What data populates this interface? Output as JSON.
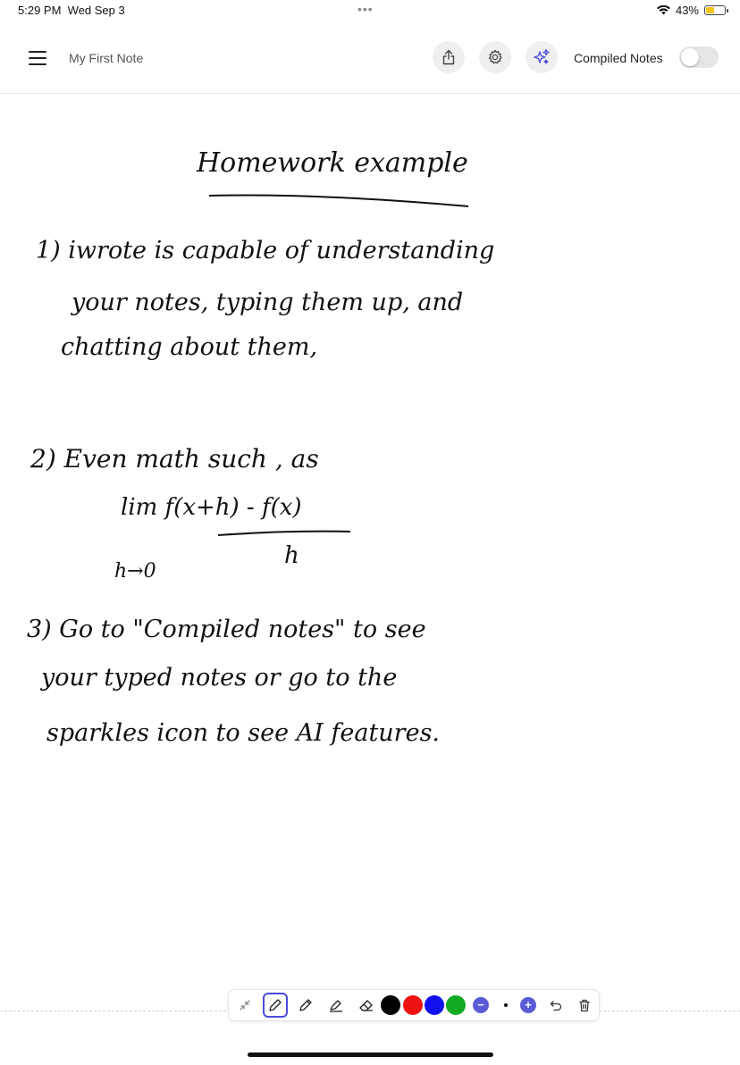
{
  "status_bar": {
    "time": "5:29 PM",
    "date": "Wed Sep 3",
    "battery": "43%",
    "battery_level": 0.43
  },
  "header": {
    "title": "My First Note",
    "compiled_label": "Compiled Notes",
    "compiled_enabled": false,
    "icons": [
      "menu-icon",
      "share-icon",
      "settings-icon",
      "sparkles-icon"
    ]
  },
  "note": {
    "heading": "Homework example",
    "lines": [
      "1) iwrote is capable of understanding",
      "your notes, typing them up, and",
      "chatting about them,",
      "2) Even math such , as",
      "lim f(x+h) - f(x)",
      "h",
      "h→0",
      "3) Go to \"Compiled notes\" to see",
      "your typed notes or go to the",
      "sparkles icon to see AI features."
    ]
  },
  "toolbar": {
    "tools": [
      "collapse-icon",
      "pen-icon",
      "pencil-icon",
      "highlighter-icon",
      "eraser-icon"
    ],
    "active_tool": "pen",
    "colors": [
      "#000000",
      "#ee1111",
      "#1111ee",
      "#11aa22"
    ],
    "minus": "−",
    "plus": "+",
    "actions": [
      "undo-icon",
      "trash-icon"
    ]
  }
}
